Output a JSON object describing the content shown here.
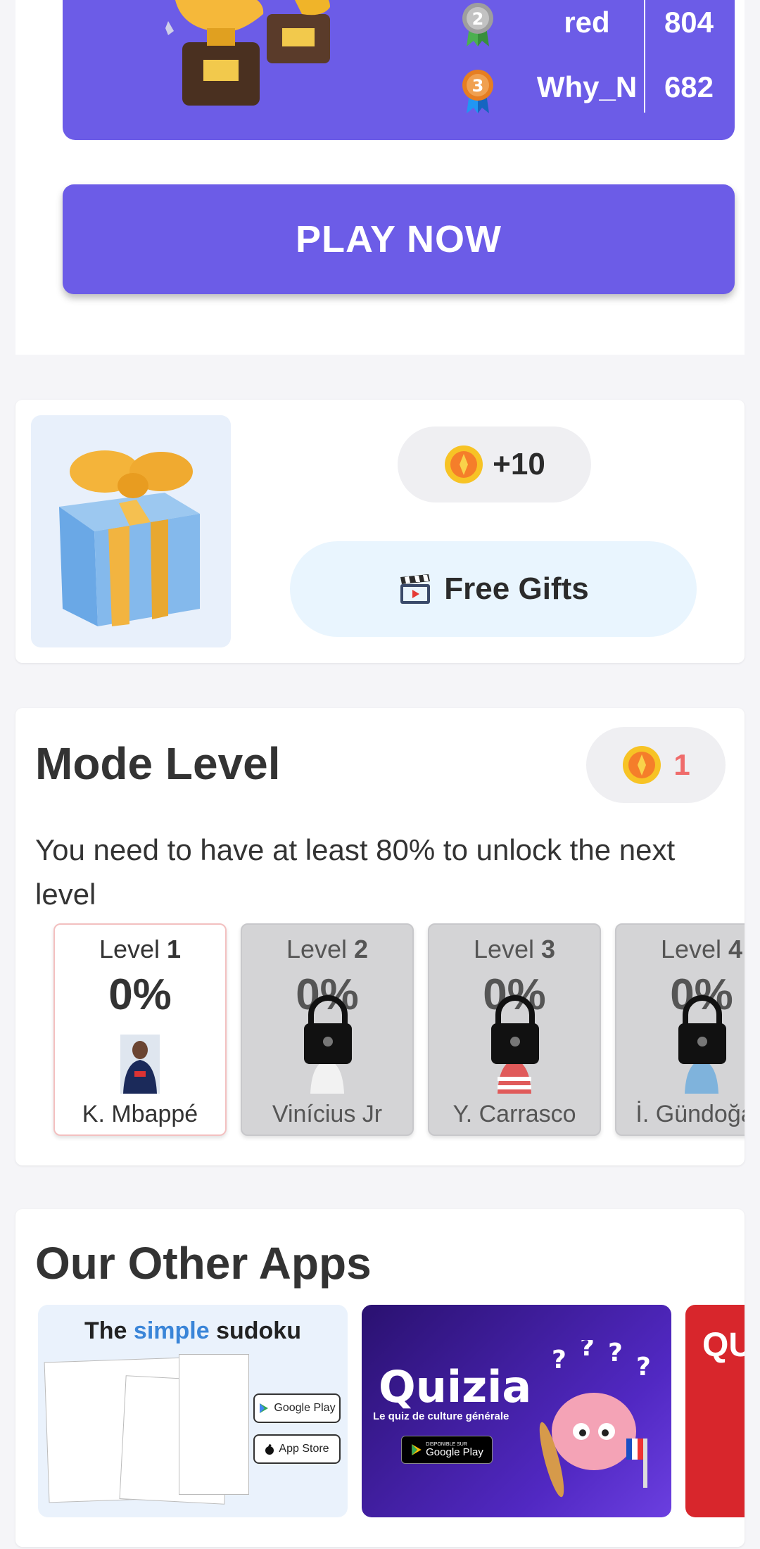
{
  "leaderboard": {
    "rows": [
      {
        "rank": "2",
        "name": "red",
        "score": "804"
      },
      {
        "rank": "3",
        "name": "Why_N",
        "score": "682"
      }
    ],
    "play_label": "PLAY NOW"
  },
  "gift": {
    "coin_amount": "+10",
    "free_gifts_label": "Free Gifts"
  },
  "mode_level": {
    "title": "Mode Level",
    "coins": "1",
    "description": "You need to have at least 80% to unlock the next level",
    "levels": [
      {
        "label": "Level",
        "number": "1",
        "percent": "0%",
        "player": "K. Mbappé",
        "locked": false
      },
      {
        "label": "Level",
        "number": "2",
        "percent": "0%",
        "player": "Vinícius Jr",
        "locked": true
      },
      {
        "label": "Level",
        "number": "3",
        "percent": "0%",
        "player": "Y. Carrasco",
        "locked": true
      },
      {
        "label": "Level",
        "number": "4",
        "percent": "0%",
        "player": "İ. Gündoğan",
        "locked": true
      }
    ]
  },
  "other_apps": {
    "title": "Our Other Apps",
    "apps": [
      {
        "title_pre": "The",
        "title_hl": "simple",
        "title_post": "sudoku",
        "google_play": "Google Play",
        "app_store": "App Store"
      },
      {
        "name": "Quizia",
        "subtitle": "Le quiz de culture générale",
        "badge_top": "DISPONIBLE SUR",
        "badge": "Google Play"
      },
      {
        "name": "QU"
      }
    ]
  },
  "colors": {
    "accent": "#6c5ce7",
    "coin_number": "#ef6b6b"
  }
}
